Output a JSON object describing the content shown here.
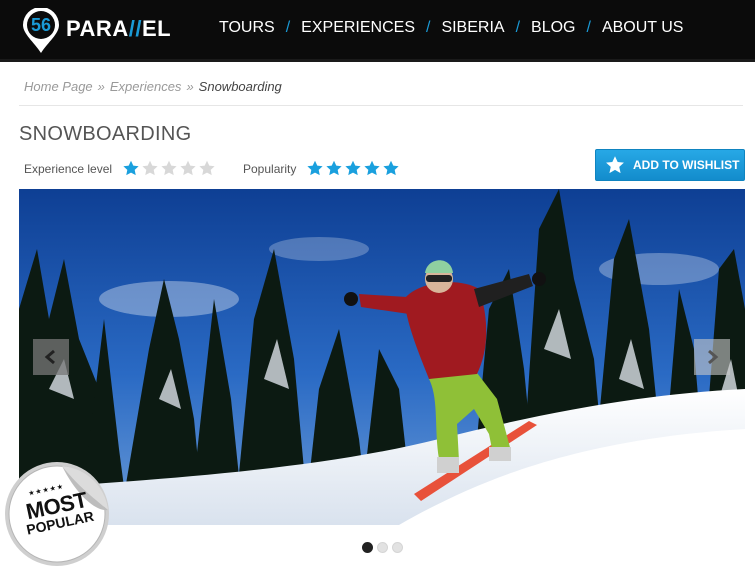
{
  "header": {
    "logo_number": "56",
    "logo_text_a": "PARA",
    "logo_text_slash": "//",
    "logo_text_b": "EL",
    "nav": [
      {
        "label": "TOURS"
      },
      {
        "label": "EXPERIENCES"
      },
      {
        "label": "SIBERIA"
      },
      {
        "label": "BLOG"
      },
      {
        "label": "ABOUT US"
      }
    ],
    "nav_separator": "/"
  },
  "breadcrumb": {
    "items": [
      "Home Page",
      "Experiences"
    ],
    "separator": "»",
    "current": "Snowboarding"
  },
  "page": {
    "title": "SNOWBOARDING",
    "experience_level": {
      "label": "Experience level",
      "rating": 1,
      "max": 5
    },
    "popularity": {
      "label": "Popularity",
      "rating": 5,
      "max": 5
    },
    "wishlist_button": "ADD TO WISHLIST"
  },
  "slider": {
    "image": "snowboarder-jumping-snow-forest",
    "slide_count": 3,
    "active_slide": 1,
    "prev_icon": "chevron-left-icon",
    "next_icon": "chevron-right-icon"
  },
  "badge": {
    "line1": "MOST",
    "line2": "POPULAR",
    "stars": "★★★★★"
  },
  "colors": {
    "accent": "#1a9ad6",
    "header_bg": "#0b0b0b",
    "star_filled": "#1aa0de",
    "star_empty": "#d8d8d8"
  }
}
